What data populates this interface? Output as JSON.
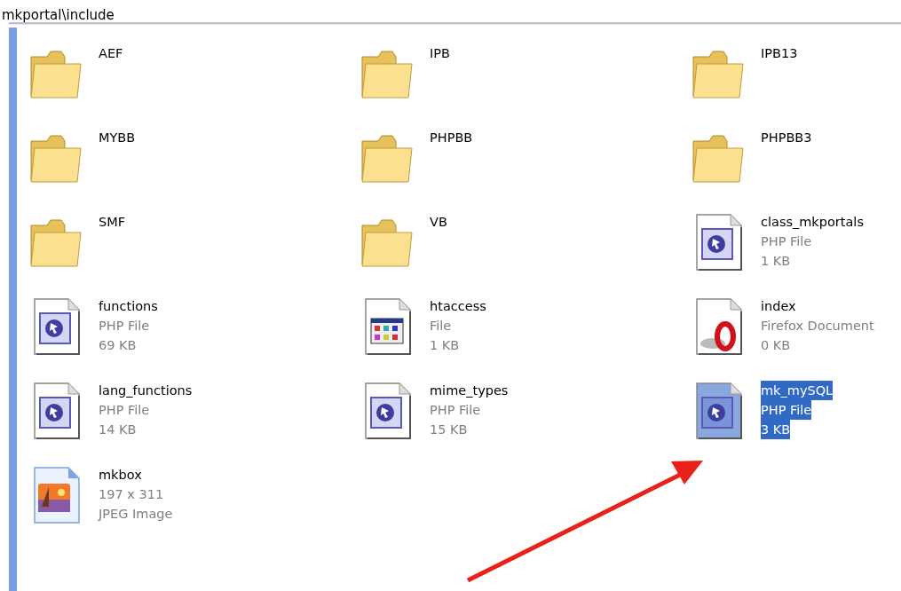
{
  "window": {
    "title": "mkportal\\include"
  },
  "items": [
    {
      "kind": "folder",
      "name": "AEF",
      "selected": false
    },
    {
      "kind": "folder",
      "name": "IPB",
      "selected": false
    },
    {
      "kind": "folder",
      "name": "IPB13",
      "selected": false
    },
    {
      "kind": "folder",
      "name": "MYBB",
      "selected": false
    },
    {
      "kind": "folder",
      "name": "PHPBB",
      "selected": false
    },
    {
      "kind": "folder",
      "name": "PHPBB3",
      "selected": false
    },
    {
      "kind": "folder",
      "name": "SMF",
      "selected": false
    },
    {
      "kind": "folder",
      "name": "VB",
      "selected": false
    },
    {
      "kind": "php",
      "name": "class_mkportals",
      "type": "PHP File",
      "size": "1 KB",
      "selected": false
    },
    {
      "kind": "php",
      "name": "functions",
      "type": "PHP File",
      "size": "69 KB",
      "selected": false
    },
    {
      "kind": "generic",
      "name": "htaccess",
      "type": "File",
      "size": "1 KB",
      "selected": false
    },
    {
      "kind": "opera",
      "name": "index",
      "type": "Firefox Document",
      "size": "0 KB",
      "selected": false
    },
    {
      "kind": "php",
      "name": "lang_functions",
      "type": "PHP File",
      "size": "14 KB",
      "selected": false
    },
    {
      "kind": "php",
      "name": "mime_types",
      "type": "PHP File",
      "size": "15 KB",
      "selected": false
    },
    {
      "kind": "php",
      "name": "mk_mySQL",
      "type": "PHP File",
      "size": "3 KB",
      "selected": true
    },
    {
      "kind": "image",
      "name": "mkbox",
      "type": "197 x 311",
      "size": "JPEG Image",
      "selected": false
    }
  ]
}
